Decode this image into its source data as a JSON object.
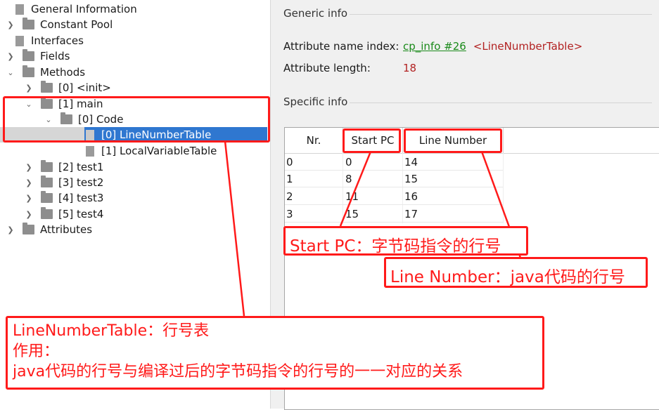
{
  "tree": {
    "items": [
      {
        "label": "General Information"
      },
      {
        "label": "Constant Pool"
      },
      {
        "label": "Interfaces"
      },
      {
        "label": "Fields"
      },
      {
        "label": "Methods"
      },
      {
        "label": "[0] <init>"
      },
      {
        "label": "[1] main"
      },
      {
        "label": "[0] Code"
      },
      {
        "label": "[0] LineNumberTable"
      },
      {
        "label": "[1] LocalVariableTable"
      },
      {
        "label": "[2] test1"
      },
      {
        "label": "[3] test2"
      },
      {
        "label": "[4] test3"
      },
      {
        "label": "[5] test4"
      },
      {
        "label": "Attributes"
      }
    ]
  },
  "generic": {
    "title": "Generic info",
    "name_index_label": "Attribute name index:",
    "name_index_link": "cp_info #26",
    "name_index_value": "<LineNumberTable>",
    "length_label": "Attribute length:",
    "length_value": "18"
  },
  "specific": {
    "title": "Specific info",
    "columns": [
      "Nr.",
      "Start PC",
      "Line Number"
    ],
    "rows": [
      [
        "0",
        "0",
        "14"
      ],
      [
        "1",
        "8",
        "15"
      ],
      [
        "2",
        "11",
        "16"
      ],
      [
        "3",
        "15",
        "17"
      ]
    ]
  },
  "annotations": {
    "start_pc": "Start PC：字节码指令的行号",
    "line_number": "Line Number：java代码的行号",
    "lnt_line1": "LineNumberTable：行号表",
    "lnt_line2": "作用：",
    "lnt_line3": "java代码的行号与编译过后的字节码指令的行号的一一对应的关系"
  },
  "colors": {
    "annotation_red": "#ff1a1a",
    "selection_blue": "#2f77d0",
    "link_green": "#1a8a1a",
    "value_red": "#b22222"
  }
}
